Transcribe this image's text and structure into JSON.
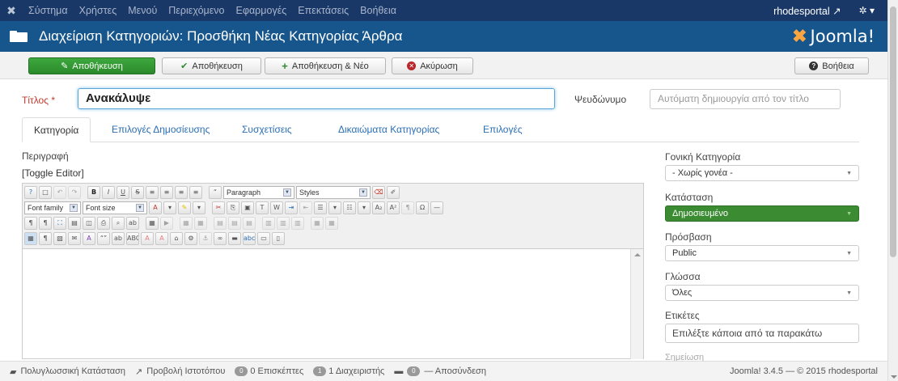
{
  "navbar": {
    "menu": [
      "Σύστημα",
      "Χρήστες",
      "Μενού",
      "Περιεχόμενο",
      "Εφαρμογές",
      "Επεκτάσεις",
      "Βοήθεια"
    ],
    "site_link": "rhodesportal",
    "site_link_icon": "external-link-icon",
    "settings_icon": "gear-icon"
  },
  "header": {
    "title": "Διαχείριση Κατηγοριών: Προσθήκη Νέας Κατηγορίας Άρθρα",
    "brand": "Joomla!"
  },
  "toolbar": {
    "save": "Αποθήκευση",
    "save_close": "Αποθήκευση",
    "save_new": "Αποθήκευση & Νέο",
    "cancel": "Ακύρωση",
    "help": "Βοήθεια"
  },
  "form": {
    "title_label": "Τίτλος *",
    "title_value": "Ανακάλυψε",
    "alias_label": "Ψευδώνυμο",
    "alias_placeholder": "Αυτόματη δημιουργία από τον τίτλο"
  },
  "tabs": [
    "Κατηγορία",
    "Επιλογές Δημοσίευσης",
    "Συσχετίσεις",
    "Δικαιώματα Κατηγορίας",
    "Επιλογές"
  ],
  "editor": {
    "description_label": "Περιγραφή",
    "toggle_label": "[Toggle Editor]",
    "format_select": "Paragraph",
    "styles_select": "Styles",
    "font_family_select": "Font family",
    "font_size_select": "Font size"
  },
  "sidebar": {
    "parent_label": "Γονική Κατηγορία",
    "parent_value": "- Χωρίς γονέα -",
    "status_label": "Κατάσταση",
    "status_value": "Δημοσιευμένο",
    "status_color": "#3b8b33",
    "access_label": "Πρόσβαση",
    "access_value": "Public",
    "language_label": "Γλώσσα",
    "language_value": "Όλες",
    "tags_label": "Ετικέτες",
    "tags_placeholder": "Επιλέξτε κάποια από τα παρακάτω",
    "notes_label": "Σημείωση"
  },
  "statusbar": {
    "multilingual": "Πολυγλωσσική Κατάσταση",
    "view_site": "Προβολή Ιστοτόπου",
    "visitors_count": "0",
    "visitors_label": "0 Επισκέπτες",
    "admins_count": "1",
    "admins_label": "1 Διαχειριστής",
    "messages_count": "0",
    "logout_label": "— Αποσύνδεση",
    "version": "Joomla! 3.4.5 — © 2015 rhodesportal"
  }
}
